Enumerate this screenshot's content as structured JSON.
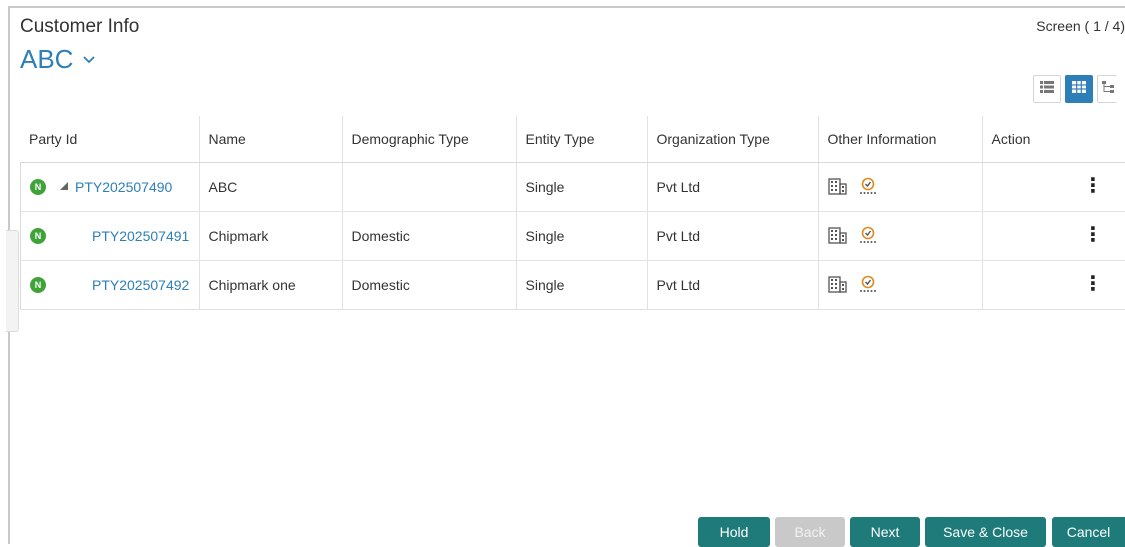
{
  "header": {
    "title": "Customer Info",
    "screen_indicator": "Screen ( 1 / 4)",
    "customer_name": "ABC"
  },
  "view_toggle": {
    "options": [
      "list-view-icon",
      "grid-view-icon",
      "tree-view-icon"
    ],
    "active": "grid-view-icon"
  },
  "table": {
    "headers": [
      "Party Id",
      "Name",
      "Demographic Type",
      "Entity Type",
      "Organization Type",
      "Other Information",
      "Action"
    ],
    "rows": [
      {
        "badge": "N",
        "party_id": "PTY202507490",
        "name": "ABC",
        "demographic_type": "",
        "entity_type": "Single",
        "organization_type": "Pvt Ltd"
      },
      {
        "badge": "N",
        "party_id": "PTY202507491",
        "name": "Chipmark",
        "demographic_type": "Domestic",
        "entity_type": "Single",
        "organization_type": "Pvt Ltd"
      },
      {
        "badge": "N",
        "party_id": "PTY202507492",
        "name": "Chipmark one",
        "demographic_type": "Domestic",
        "entity_type": "Single",
        "organization_type": "Pvt Ltd"
      }
    ]
  },
  "footer": {
    "hold": "Hold",
    "back": "Back",
    "next": "Next",
    "save_close": "Save & Close",
    "cancel": "Cancel"
  },
  "colors": {
    "accent": "#2d7fb8",
    "button_teal": "#1f7a7a",
    "badge_green": "#3fa33a",
    "disabled": "#c9c9c9"
  }
}
